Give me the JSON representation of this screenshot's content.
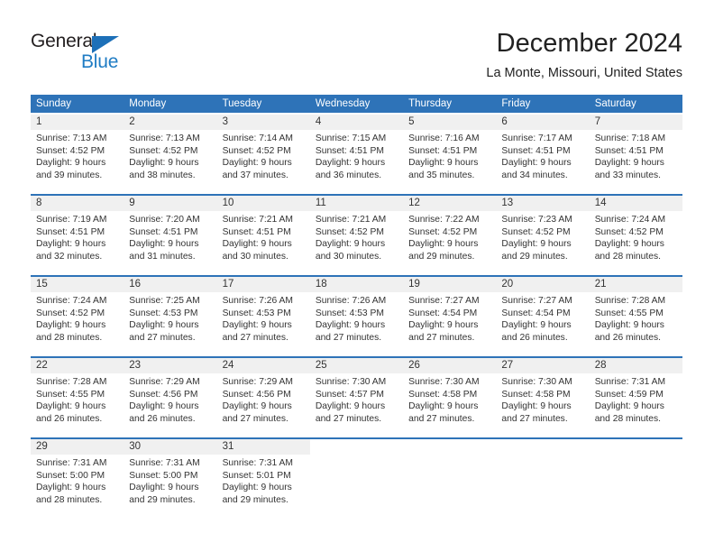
{
  "brand": {
    "name_part1": "General",
    "name_part2": "Blue",
    "triangle_icon": "blue-triangle-logo-mark",
    "color_dark": "#231f20",
    "color_blue": "#1f7cc4"
  },
  "header": {
    "title": "December 2024",
    "subtitle": "La Monte, Missouri, United States"
  },
  "theme": {
    "header_bg": "#2e73b8",
    "day_band_bg": "#f0f0f0",
    "text": "#333333"
  },
  "calendar": {
    "weekdays": [
      "Sunday",
      "Monday",
      "Tuesday",
      "Wednesday",
      "Thursday",
      "Friday",
      "Saturday"
    ],
    "weeks": [
      [
        {
          "day": "1",
          "sunrise": "Sunrise: 7:13 AM",
          "sunset": "Sunset: 4:52 PM",
          "daylight1": "Daylight: 9 hours",
          "daylight2": "and 39 minutes."
        },
        {
          "day": "2",
          "sunrise": "Sunrise: 7:13 AM",
          "sunset": "Sunset: 4:52 PM",
          "daylight1": "Daylight: 9 hours",
          "daylight2": "and 38 minutes."
        },
        {
          "day": "3",
          "sunrise": "Sunrise: 7:14 AM",
          "sunset": "Sunset: 4:52 PM",
          "daylight1": "Daylight: 9 hours",
          "daylight2": "and 37 minutes."
        },
        {
          "day": "4",
          "sunrise": "Sunrise: 7:15 AM",
          "sunset": "Sunset: 4:51 PM",
          "daylight1": "Daylight: 9 hours",
          "daylight2": "and 36 minutes."
        },
        {
          "day": "5",
          "sunrise": "Sunrise: 7:16 AM",
          "sunset": "Sunset: 4:51 PM",
          "daylight1": "Daylight: 9 hours",
          "daylight2": "and 35 minutes."
        },
        {
          "day": "6",
          "sunrise": "Sunrise: 7:17 AM",
          "sunset": "Sunset: 4:51 PM",
          "daylight1": "Daylight: 9 hours",
          "daylight2": "and 34 minutes."
        },
        {
          "day": "7",
          "sunrise": "Sunrise: 7:18 AM",
          "sunset": "Sunset: 4:51 PM",
          "daylight1": "Daylight: 9 hours",
          "daylight2": "and 33 minutes."
        }
      ],
      [
        {
          "day": "8",
          "sunrise": "Sunrise: 7:19 AM",
          "sunset": "Sunset: 4:51 PM",
          "daylight1": "Daylight: 9 hours",
          "daylight2": "and 32 minutes."
        },
        {
          "day": "9",
          "sunrise": "Sunrise: 7:20 AM",
          "sunset": "Sunset: 4:51 PM",
          "daylight1": "Daylight: 9 hours",
          "daylight2": "and 31 minutes."
        },
        {
          "day": "10",
          "sunrise": "Sunrise: 7:21 AM",
          "sunset": "Sunset: 4:51 PM",
          "daylight1": "Daylight: 9 hours",
          "daylight2": "and 30 minutes."
        },
        {
          "day": "11",
          "sunrise": "Sunrise: 7:21 AM",
          "sunset": "Sunset: 4:52 PM",
          "daylight1": "Daylight: 9 hours",
          "daylight2": "and 30 minutes."
        },
        {
          "day": "12",
          "sunrise": "Sunrise: 7:22 AM",
          "sunset": "Sunset: 4:52 PM",
          "daylight1": "Daylight: 9 hours",
          "daylight2": "and 29 minutes."
        },
        {
          "day": "13",
          "sunrise": "Sunrise: 7:23 AM",
          "sunset": "Sunset: 4:52 PM",
          "daylight1": "Daylight: 9 hours",
          "daylight2": "and 29 minutes."
        },
        {
          "day": "14",
          "sunrise": "Sunrise: 7:24 AM",
          "sunset": "Sunset: 4:52 PM",
          "daylight1": "Daylight: 9 hours",
          "daylight2": "and 28 minutes."
        }
      ],
      [
        {
          "day": "15",
          "sunrise": "Sunrise: 7:24 AM",
          "sunset": "Sunset: 4:52 PM",
          "daylight1": "Daylight: 9 hours",
          "daylight2": "and 28 minutes."
        },
        {
          "day": "16",
          "sunrise": "Sunrise: 7:25 AM",
          "sunset": "Sunset: 4:53 PM",
          "daylight1": "Daylight: 9 hours",
          "daylight2": "and 27 minutes."
        },
        {
          "day": "17",
          "sunrise": "Sunrise: 7:26 AM",
          "sunset": "Sunset: 4:53 PM",
          "daylight1": "Daylight: 9 hours",
          "daylight2": "and 27 minutes."
        },
        {
          "day": "18",
          "sunrise": "Sunrise: 7:26 AM",
          "sunset": "Sunset: 4:53 PM",
          "daylight1": "Daylight: 9 hours",
          "daylight2": "and 27 minutes."
        },
        {
          "day": "19",
          "sunrise": "Sunrise: 7:27 AM",
          "sunset": "Sunset: 4:54 PM",
          "daylight1": "Daylight: 9 hours",
          "daylight2": "and 27 minutes."
        },
        {
          "day": "20",
          "sunrise": "Sunrise: 7:27 AM",
          "sunset": "Sunset: 4:54 PM",
          "daylight1": "Daylight: 9 hours",
          "daylight2": "and 26 minutes."
        },
        {
          "day": "21",
          "sunrise": "Sunrise: 7:28 AM",
          "sunset": "Sunset: 4:55 PM",
          "daylight1": "Daylight: 9 hours",
          "daylight2": "and 26 minutes."
        }
      ],
      [
        {
          "day": "22",
          "sunrise": "Sunrise: 7:28 AM",
          "sunset": "Sunset: 4:55 PM",
          "daylight1": "Daylight: 9 hours",
          "daylight2": "and 26 minutes."
        },
        {
          "day": "23",
          "sunrise": "Sunrise: 7:29 AM",
          "sunset": "Sunset: 4:56 PM",
          "daylight1": "Daylight: 9 hours",
          "daylight2": "and 26 minutes."
        },
        {
          "day": "24",
          "sunrise": "Sunrise: 7:29 AM",
          "sunset": "Sunset: 4:56 PM",
          "daylight1": "Daylight: 9 hours",
          "daylight2": "and 27 minutes."
        },
        {
          "day": "25",
          "sunrise": "Sunrise: 7:30 AM",
          "sunset": "Sunset: 4:57 PM",
          "daylight1": "Daylight: 9 hours",
          "daylight2": "and 27 minutes."
        },
        {
          "day": "26",
          "sunrise": "Sunrise: 7:30 AM",
          "sunset": "Sunset: 4:58 PM",
          "daylight1": "Daylight: 9 hours",
          "daylight2": "and 27 minutes."
        },
        {
          "day": "27",
          "sunrise": "Sunrise: 7:30 AM",
          "sunset": "Sunset: 4:58 PM",
          "daylight1": "Daylight: 9 hours",
          "daylight2": "and 27 minutes."
        },
        {
          "day": "28",
          "sunrise": "Sunrise: 7:31 AM",
          "sunset": "Sunset: 4:59 PM",
          "daylight1": "Daylight: 9 hours",
          "daylight2": "and 28 minutes."
        }
      ],
      [
        {
          "day": "29",
          "sunrise": "Sunrise: 7:31 AM",
          "sunset": "Sunset: 5:00 PM",
          "daylight1": "Daylight: 9 hours",
          "daylight2": "and 28 minutes."
        },
        {
          "day": "30",
          "sunrise": "Sunrise: 7:31 AM",
          "sunset": "Sunset: 5:00 PM",
          "daylight1": "Daylight: 9 hours",
          "daylight2": "and 29 minutes."
        },
        {
          "day": "31",
          "sunrise": "Sunrise: 7:31 AM",
          "sunset": "Sunset: 5:01 PM",
          "daylight1": "Daylight: 9 hours",
          "daylight2": "and 29 minutes."
        },
        {
          "day": "",
          "sunrise": "",
          "sunset": "",
          "daylight1": "",
          "daylight2": ""
        },
        {
          "day": "",
          "sunrise": "",
          "sunset": "",
          "daylight1": "",
          "daylight2": ""
        },
        {
          "day": "",
          "sunrise": "",
          "sunset": "",
          "daylight1": "",
          "daylight2": ""
        },
        {
          "day": "",
          "sunrise": "",
          "sunset": "",
          "daylight1": "",
          "daylight2": ""
        }
      ]
    ]
  }
}
